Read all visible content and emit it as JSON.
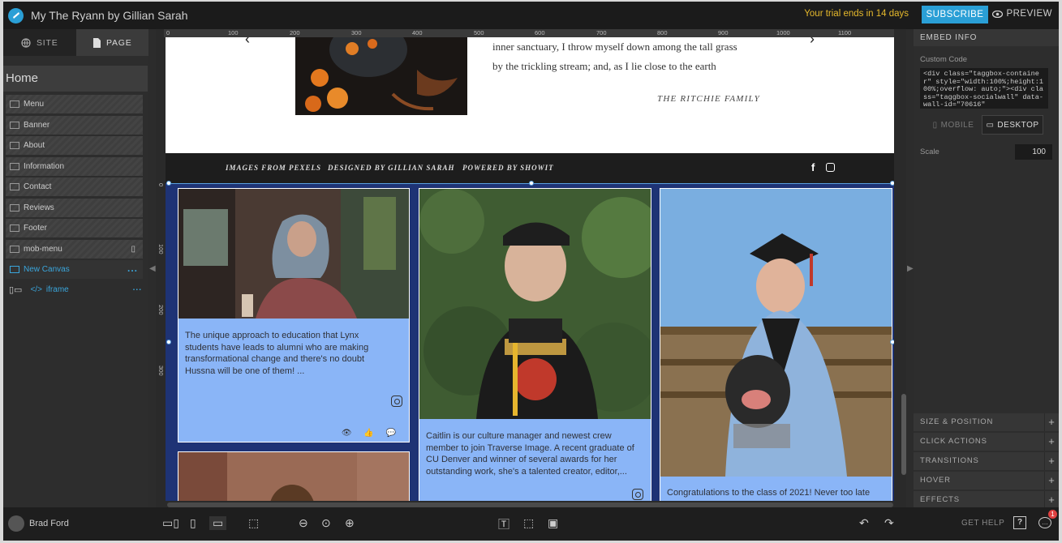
{
  "topbar": {
    "title": "My The Ryann by Gillian Sarah",
    "trial": "Your trial ends in 14 days",
    "subscribe": "SUBSCRIBE",
    "preview": "PREVIEW"
  },
  "left": {
    "tab_site": "SITE",
    "tab_page": "PAGE",
    "home": "Home",
    "items": [
      {
        "label": "Menu"
      },
      {
        "label": "Banner"
      },
      {
        "label": "About"
      },
      {
        "label": "Information"
      },
      {
        "label": "Contact"
      },
      {
        "label": "Reviews"
      },
      {
        "label": "Footer"
      },
      {
        "label": "mob-menu"
      },
      {
        "label": "New Canvas"
      }
    ],
    "iframe": "iframe",
    "dots": "..."
  },
  "canvas": {
    "ruler_top": [
      "0",
      "100",
      "200",
      "300",
      "400",
      "500",
      "600",
      "700",
      "800",
      "900",
      "1000",
      "1100"
    ],
    "ruler_left": [
      "0",
      "100",
      "200",
      "300"
    ],
    "quote_lines": [
      "inner sanctuary, I throw myself down among the tall grass",
      "by the trickling stream; and, as I lie close to the earth"
    ],
    "quote_author": "THE RITCHIE FAMILY",
    "footer_links": [
      "IMAGES FROM PEXELS",
      "DESIGNED BY GILLIAN SARAH",
      "POWERED BY SHOWIT"
    ],
    "fb_glyph": "f",
    "cards": [
      {
        "text": "The unique approach to education that Lynx students have leads to alumni who are making transformational change and there's no doubt Hussna will be one of them! ..."
      },
      {
        "text": "Caitlin is our culture manager and newest crew member to join Traverse Image. A recent graduate of CU Denver and winner of several awards for her outstanding work, she's a talented creator, editor,..."
      },
      {
        "text": "Congratulations to the class of 2021! Never too late"
      }
    ],
    "stats": "👁 👍 💬"
  },
  "right": {
    "head": "EMBED INFO",
    "custom_code_label": "Custom Code",
    "code": "<div class=\"taggbox-container\" style=\"width:100%;height:100%;overflow: auto;\"><div class=\"taggbox-socialwall\" data-wall-id=\"70616\"",
    "mobile": "MOBILE",
    "desktop": "DESKTOP",
    "scale_label": "Scale",
    "scale_value": "100",
    "sections": [
      "SIZE & POSITION",
      "CLICK ACTIONS",
      "TRANSITIONS",
      "HOVER",
      "EFFECTS"
    ],
    "plus": "+"
  },
  "bottom": {
    "user": "Brad Ford",
    "get_help": "GET HELP",
    "question": "?",
    "badge": "1",
    "tools": {
      "undo": "↶",
      "redo": "↷"
    }
  },
  "colors": {
    "accent": "#2a9fd6",
    "trial": "#e6b92c",
    "feed_bg": "#1e3375",
    "card_bg": "#8ab5f7"
  }
}
